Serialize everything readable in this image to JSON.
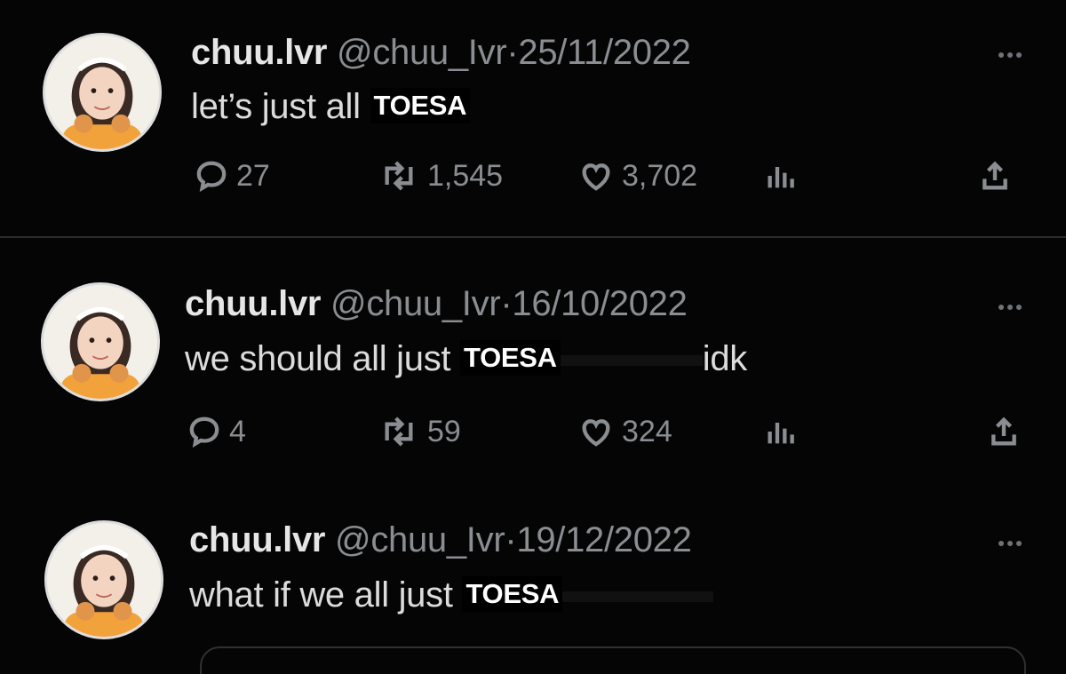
{
  "tweets": [
    {
      "name": "chuu.lvr",
      "handle": "@chuu_Ivr",
      "dot": "·",
      "date": "25/11/2022",
      "text_before": "let’s just all ",
      "overlay": "TOESA",
      "text_after": "",
      "replies": "27",
      "retweets": "1,545",
      "likes": "3,702"
    },
    {
      "name": "chuu.lvr",
      "handle": "@chuu_Ivr",
      "dot": "·",
      "date": "16/10/2022",
      "text_before": "we should all just ",
      "overlay": "TOESA",
      "text_after": "idk",
      "replies": "4",
      "retweets": "59",
      "likes": "324"
    },
    {
      "name": "chuu.lvr",
      "handle": "@chuu_Ivr",
      "dot": "·",
      "date": "19/12/2022",
      "text_before": "what if we all just ",
      "overlay": "TOESA",
      "text_after": "",
      "replies": "",
      "retweets": "",
      "likes": ""
    }
  ],
  "icons": {
    "reply": "reply-bubble-icon",
    "retweet": "retweet-icon",
    "like": "heart-icon",
    "views": "analytics-bars-icon",
    "share": "share-upload-icon",
    "more": "more-dots-icon"
  },
  "colors": {
    "background": "#050505",
    "muted": "#8a8d91",
    "text": "#dcdcdc"
  }
}
